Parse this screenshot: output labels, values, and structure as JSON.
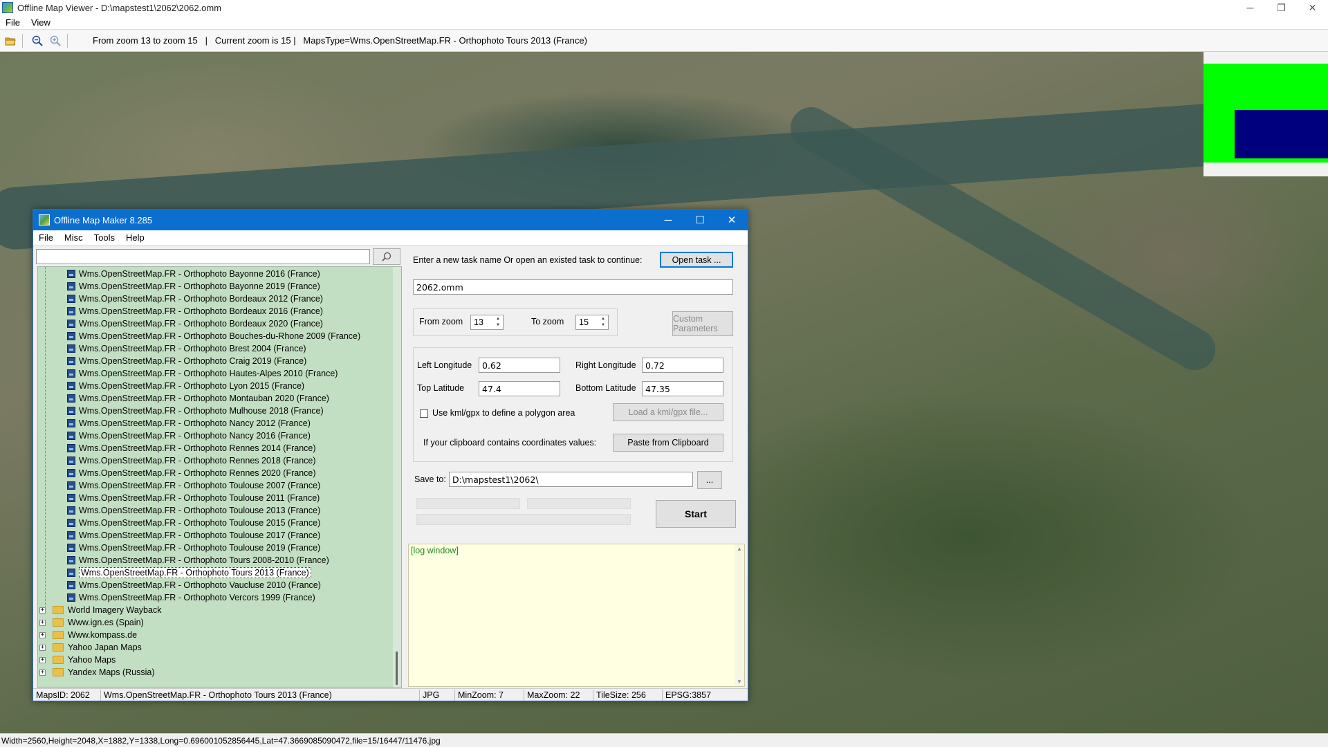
{
  "window": {
    "title": "Offline Map Viewer - D:\\mapstest1\\2062\\2062.omm",
    "controls": {
      "minimize": "─",
      "restore": "❐",
      "close": "✕"
    }
  },
  "menu": [
    "File",
    "View"
  ],
  "toolbar": {
    "icons": [
      "open-folder-icon",
      "zoom-out-icon",
      "zoom-in-icon"
    ],
    "info": "From zoom 13 to zoom 15   |   Current zoom is 15 |   MapsType=Wms.OpenStreetMap.FR - Orthophoto Tours 2013 (France)"
  },
  "colors": {
    "minimap_green": "#00ff00",
    "minimap_blue": "#00007f",
    "dialog_title": "#0b6fd0",
    "tree_bg": "#c3dfc3",
    "log_bg": "#ffffe1"
  },
  "status": "Width=2560,Height=2048,X=1882,Y=1338,Long=0.696001052856445,Lat=47.3669085090472,file=15/16447/11476.jpg",
  "dialog": {
    "title": "Offline Map Maker 8.285",
    "controls": {
      "minimize": "─",
      "maximize": "☐",
      "close": "✕"
    },
    "menu": [
      "File",
      "Misc",
      "Tools",
      "Help"
    ],
    "search": {
      "value": "",
      "icon": "search-icon"
    },
    "tree": {
      "items": [
        "Wms.OpenStreetMap.FR - Orthophoto Bayonne 2016 (France)",
        "Wms.OpenStreetMap.FR - Orthophoto Bayonne 2019 (France)",
        "Wms.OpenStreetMap.FR - Orthophoto Bordeaux 2012 (France)",
        "Wms.OpenStreetMap.FR - Orthophoto Bordeaux 2016 (France)",
        "Wms.OpenStreetMap.FR - Orthophoto Bordeaux 2020 (France)",
        "Wms.OpenStreetMap.FR - Orthophoto Bouches-du-Rhone 2009 (France)",
        "Wms.OpenStreetMap.FR - Orthophoto Brest 2004 (France)",
        "Wms.OpenStreetMap.FR - Orthophoto Craig 2019 (France)",
        "Wms.OpenStreetMap.FR - Orthophoto Hautes-Alpes 2010 (France)",
        "Wms.OpenStreetMap.FR - Orthophoto Lyon 2015 (France)",
        "Wms.OpenStreetMap.FR - Orthophoto Montauban 2020 (France)",
        "Wms.OpenStreetMap.FR - Orthophoto Mulhouse 2018 (France)",
        "Wms.OpenStreetMap.FR - Orthophoto Nancy 2012 (France)",
        "Wms.OpenStreetMap.FR - Orthophoto Nancy 2016 (France)",
        "Wms.OpenStreetMap.FR - Orthophoto Rennes 2014 (France)",
        "Wms.OpenStreetMap.FR - Orthophoto Rennes 2018 (France)",
        "Wms.OpenStreetMap.FR - Orthophoto Rennes 2020 (France)",
        "Wms.OpenStreetMap.FR - Orthophoto Toulouse 2007 (France)",
        "Wms.OpenStreetMap.FR - Orthophoto Toulouse 2011 (France)",
        "Wms.OpenStreetMap.FR - Orthophoto Toulouse 2013 (France)",
        "Wms.OpenStreetMap.FR - Orthophoto Toulouse 2015 (France)",
        "Wms.OpenStreetMap.FR - Orthophoto Toulouse 2017 (France)",
        "Wms.OpenStreetMap.FR - Orthophoto Toulouse 2019 (France)",
        "Wms.OpenStreetMap.FR - Orthophoto Tours 2008-2010 (France)",
        "Wms.OpenStreetMap.FR - Orthophoto Tours 2013 (France)",
        "Wms.OpenStreetMap.FR - Orthophoto Vaucluse 2010 (France)",
        "Wms.OpenStreetMap.FR - Orthophoto Vercors 1999 (France)"
      ],
      "selected": "Wms.OpenStreetMap.FR - Orthophoto Tours 2013 (France)",
      "folders": [
        "World Imagery Wayback",
        "Www.ign.es (Spain)",
        "Www.kompass.de",
        "Yahoo Japan Maps",
        "Yahoo Maps",
        "Yandex Maps (Russia)"
      ]
    },
    "task": {
      "prompt": "Enter a new task name Or open an existed task to continue:",
      "open_button": "Open task ...",
      "name": "2062.omm"
    },
    "zoom": {
      "from_label": "From zoom",
      "from_value": "13",
      "to_label": "To zoom",
      "to_value": "15",
      "custom_button": "Custom Parameters"
    },
    "coords": {
      "left_label": "Left Longitude",
      "left_value": "0.62",
      "right_label": "Right Longitude",
      "right_value": "0.72",
      "top_label": "Top Latitude",
      "top_value": "47.4",
      "bottom_label": "Bottom Latitude",
      "bottom_value": "47.35",
      "kml_label": "Use kml/gpx to define a polygon area",
      "kml_checked": false,
      "kml_button": "Load a kml/gpx file...",
      "clipboard_label": "If your clipboard contains coordinates values:",
      "clipboard_button": "Paste from Clipboard"
    },
    "save": {
      "label": "Save to:",
      "path": "D:\\mapstest1\\2062\\",
      "browse": "..."
    },
    "start_button": "Start",
    "log": "[log window]",
    "status": {
      "mapsid": "MapsID: 2062",
      "maptype": "Wms.OpenStreetMap.FR - Orthophoto Tours 2013 (France)",
      "format": "JPG",
      "minzoom": "MinZoom: 7",
      "maxzoom": "MaxZoom: 22",
      "tilesize": "TileSize: 256",
      "epsg": "EPSG:3857"
    }
  }
}
